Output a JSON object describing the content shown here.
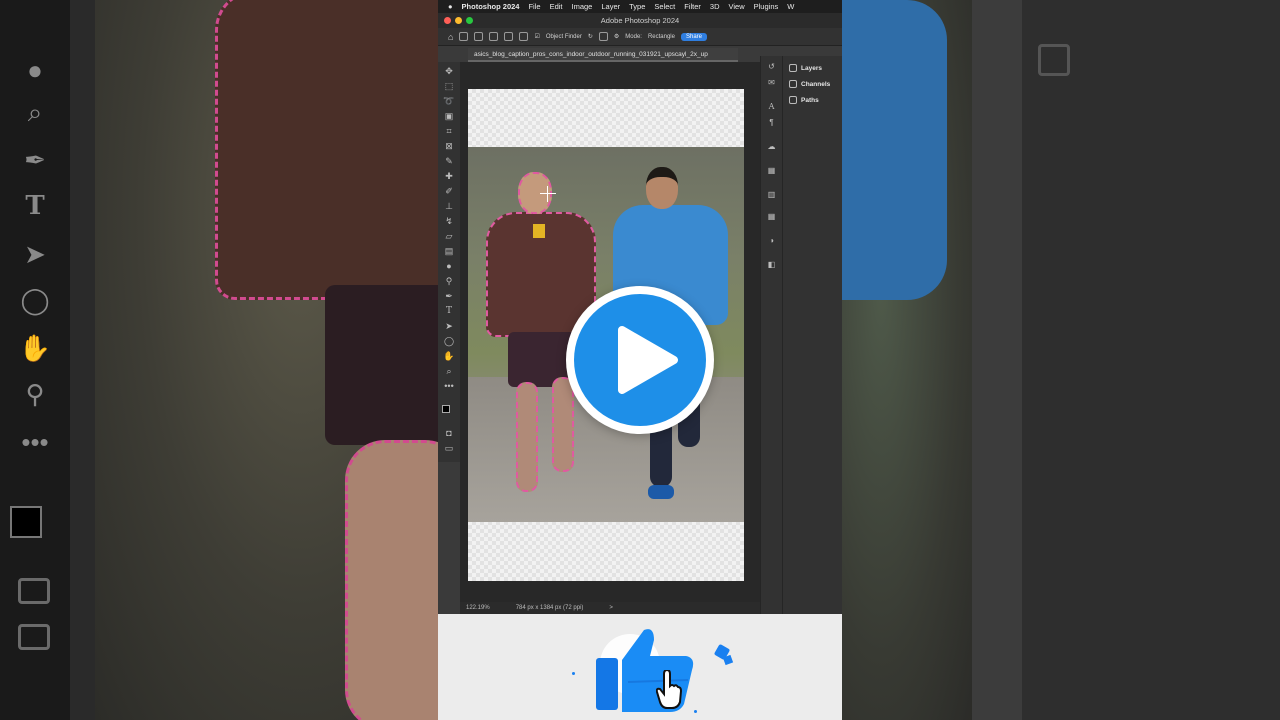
{
  "menubar": {
    "app_name": "Photoshop 2024",
    "items": [
      "File",
      "Edit",
      "Image",
      "Layer",
      "Type",
      "Select",
      "Filter",
      "3D",
      "View",
      "Plugins",
      "W"
    ]
  },
  "window": {
    "title": "Adobe Photoshop 2024"
  },
  "options": {
    "object_finder": "Object Finder",
    "mode_label": "Mode:",
    "mode_value": "Rectangle",
    "share_label": "Share"
  },
  "document": {
    "tab_name": "asics_blog_caption_pros_cons_indoor_outdoor_running_031921_upscayl_2x_up"
  },
  "status": {
    "zoom": "122.19%",
    "doc_info": "784 px x 1384 px (72 ppi)",
    "arrow": ">"
  },
  "panels": {
    "items": [
      "Layers",
      "Channels",
      "Paths"
    ]
  },
  "overlay": {
    "play_icon": "play-icon",
    "like_icon": "thumbs-up-icon",
    "cursor_icon": "hand-cursor-icon"
  },
  "colors": {
    "accent_blue": "#1e8fe8",
    "selection_pink": "#e05aa0",
    "share_blue": "#2f7ee0"
  }
}
